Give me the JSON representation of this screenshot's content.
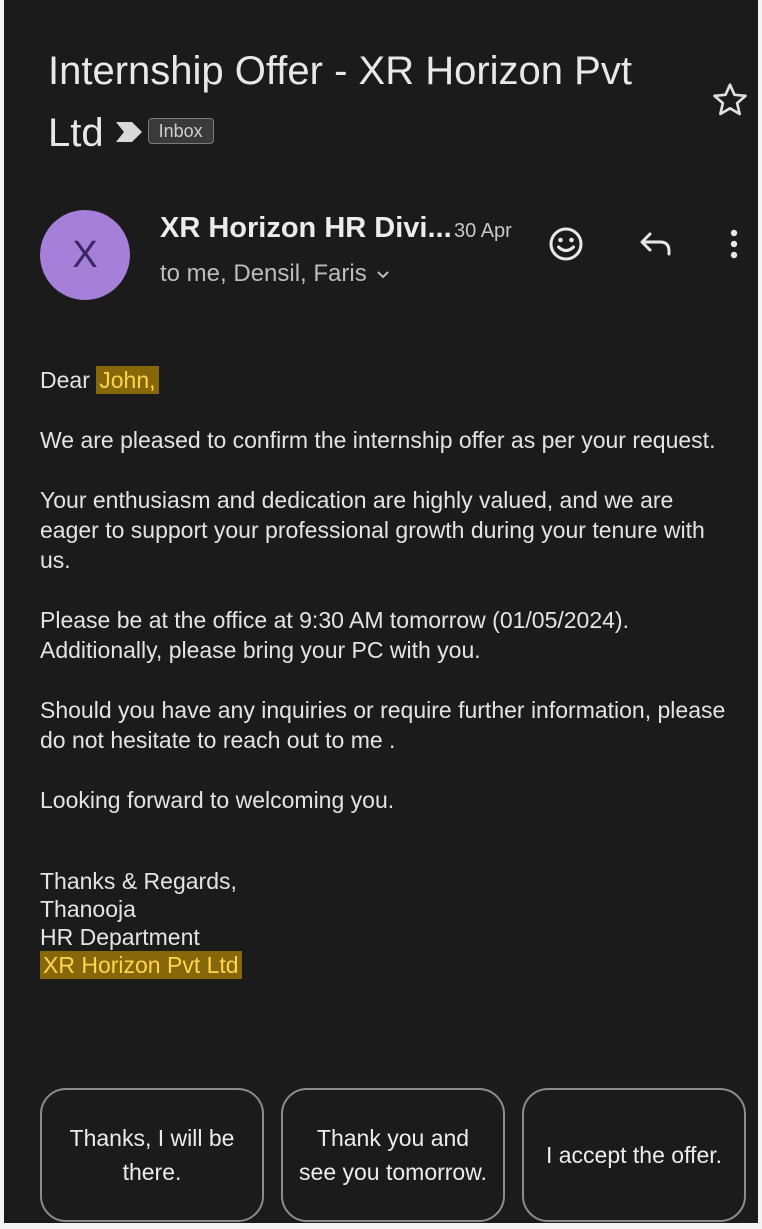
{
  "email": {
    "subject": "Internship Offer - XR Horizon Pvt Ltd",
    "label_chip": "Inbox",
    "sender": {
      "avatar_letter": "X",
      "avatar_color": "#a57fd8",
      "name": "XR Horizon HR Divi...",
      "date": "30 Apr",
      "recipients": "to me, Densil, Faris"
    },
    "body": {
      "greeting_prefix": "Dear",
      "greeting_name": "John,",
      "paragraphs": [
        "We are pleased to confirm the internship offer as per your request.",
        "Your enthusiasm and dedication are highly valued, and we are eager to support your professional growth during your tenure with us.",
        "Please be at the office at 9:30 AM tomorrow (01/05/2024). Additionally, please bring your PC with you.",
        "Should you have any inquiries or require further information, please do not hesitate to reach out to me .",
        "Looking forward to welcoming you."
      ],
      "signature": {
        "closing": "Thanks & Regards,",
        "name": "Thanooja",
        "department": "HR Department",
        "company": "XR Horizon Pvt Ltd"
      }
    },
    "smart_replies": [
      "Thanks, I will be there.",
      "Thank you and see you tomorrow.",
      "I accept the offer."
    ]
  },
  "icons": [
    "star-icon",
    "label-arrow-icon",
    "emoji-icon",
    "reply-icon",
    "more-vert-icon",
    "chevron-down-icon"
  ],
  "colors": {
    "background": "#1b1b1b",
    "highlight_bg": "#86670a",
    "highlight_text": "#ffd54f"
  }
}
